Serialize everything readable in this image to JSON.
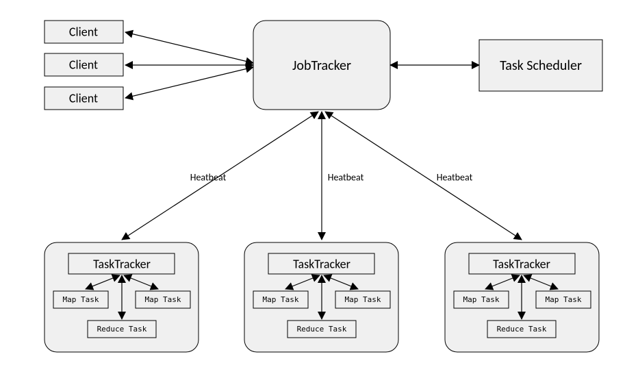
{
  "clients": [
    "Client",
    "Client",
    "Client"
  ],
  "jobtracker": "JobTracker",
  "scheduler": "Task Scheduler",
  "heartbeat_label": "Heatbeat",
  "tasktrackers": [
    {
      "title": "TaskTracker",
      "tasks": [
        "Map Task",
        "Map Task",
        "Reduce Task"
      ]
    },
    {
      "title": "TaskTracker",
      "tasks": [
        "Map Task",
        "Map Task",
        "Reduce Task"
      ]
    },
    {
      "title": "TaskTracker",
      "tasks": [
        "Map Task",
        "Map Task",
        "Reduce Task"
      ]
    }
  ]
}
